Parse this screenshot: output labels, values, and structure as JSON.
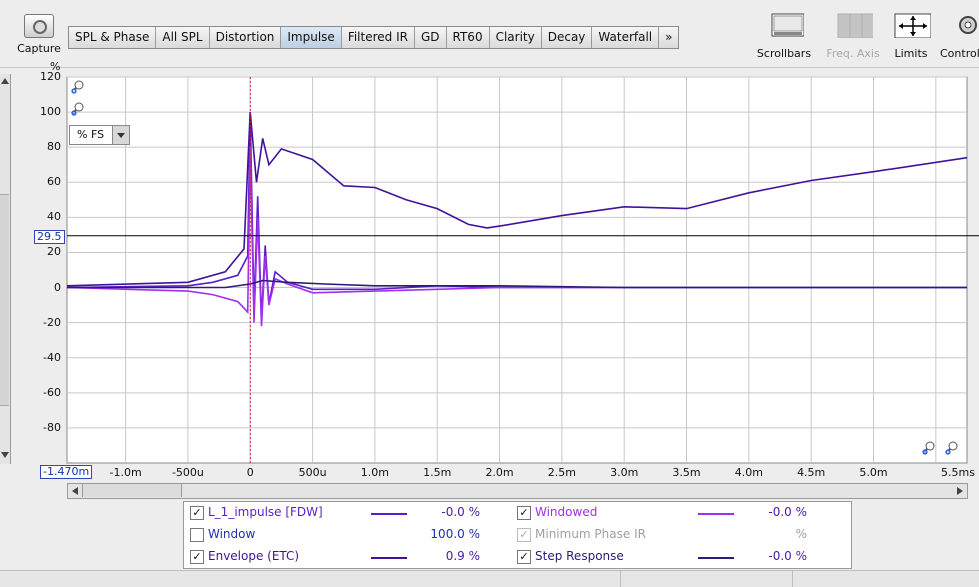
{
  "toolbar": {
    "capture_label": "Capture",
    "tabs": [
      "SPL & Phase",
      "All SPL",
      "Distortion",
      "Impulse",
      "Filtered IR",
      "GD",
      "RT60",
      "Clarity",
      "Decay",
      "Waterfall",
      "»"
    ],
    "active_tab": "Impulse",
    "scrollbars_label": "Scrollbars",
    "freq_axis_label": "Freq. Axis",
    "limits_label": "Limits",
    "controls_label": "Controls"
  },
  "plot": {
    "y_unit": "%",
    "unit_select_value": "% FS",
    "y_ticks": [
      "120",
      "100",
      "80",
      "60",
      "40",
      "20",
      "0",
      "-20",
      "-40",
      "-60",
      "-80"
    ],
    "x_ticks": [
      "-1.0m",
      "-500u",
      "0",
      "500u",
      "1.0m",
      "1.5m",
      "2.0m",
      "2.5m",
      "3.0m",
      "3.5m",
      "4.0m",
      "4.5m",
      "5.0m",
      "5.5ms"
    ],
    "cursor_y_readout": "29.5",
    "cursor_x_readout": "-1.470m"
  },
  "chart_data": {
    "type": "line",
    "title": "",
    "xlabel": "",
    "ylabel": "%",
    "x_unit": "ms",
    "xlim": [
      -1.47,
      5.75
    ],
    "ylim": [
      -100,
      120
    ],
    "grid": true,
    "series": [
      {
        "name": "L_1_impulse [FDW]",
        "color": "#5a1ec8",
        "x": [
          -1.47,
          -0.5,
          -0.3,
          -0.1,
          -0.02,
          0.0,
          0.03,
          0.06,
          0.09,
          0.12,
          0.15,
          0.2,
          0.3,
          0.5,
          1.0,
          1.5,
          2.0,
          3.0,
          4.0,
          5.0,
          5.75
        ],
        "y": [
          0,
          1,
          3,
          7,
          18,
          100,
          -12,
          52,
          -18,
          24,
          -9,
          9,
          3,
          -1,
          -1,
          1,
          0,
          0,
          0,
          0,
          0
        ]
      },
      {
        "name": "Windowed",
        "color": "#a030ee",
        "x": [
          -1.47,
          -0.5,
          -0.3,
          -0.1,
          -0.02,
          0.0,
          0.03,
          0.06,
          0.09,
          0.12,
          0.15,
          0.2,
          0.3,
          0.5,
          1.0,
          1.5,
          2.0,
          3.0,
          4.0,
          5.0,
          5.75
        ],
        "y": [
          0,
          -2,
          -4,
          -8,
          -14,
          80,
          -20,
          40,
          -22,
          18,
          -10,
          5,
          2,
          -3,
          -2,
          -1,
          0,
          0,
          0,
          0,
          0
        ]
      },
      {
        "name": "Envelope (ETC)",
        "color": "#40129c",
        "x": [
          -1.47,
          -0.5,
          -0.2,
          -0.05,
          0.0,
          0.05,
          0.1,
          0.15,
          0.25,
          0.5,
          0.75,
          1.0,
          1.25,
          1.5,
          1.75,
          1.9,
          2.0,
          2.5,
          3.0,
          3.5,
          4.0,
          4.5,
          5.0,
          5.75
        ],
        "y": [
          1,
          3,
          9,
          22,
          100,
          60,
          85,
          70,
          79,
          73,
          58,
          57,
          50,
          45,
          36,
          34,
          35,
          41,
          46,
          45,
          54,
          61,
          66,
          74
        ]
      },
      {
        "name": "Step Response",
        "color": "#2a1a7a",
        "x": [
          -1.47,
          -0.2,
          0.0,
          0.1,
          0.3,
          0.6,
          1.0,
          2.0,
          3.0,
          4.0,
          5.0,
          5.75
        ],
        "y": [
          0,
          0,
          2,
          4,
          3,
          2,
          1,
          1,
          0,
          0,
          0,
          0
        ]
      }
    ],
    "cursor": {
      "x": 0.0,
      "y": 29.5
    }
  },
  "legend": {
    "rows": [
      {
        "left": {
          "checked": true,
          "enabled": true,
          "name": "L_1_impulse [FDW]",
          "color": "#5a1ec8",
          "value": "-0.0 %"
        },
        "right": {
          "checked": true,
          "enabled": true,
          "name": "Windowed",
          "color": "#a030ee",
          "value": "-0.0 %"
        }
      },
      {
        "left": {
          "checked": false,
          "enabled": true,
          "name": "Window",
          "color": "",
          "value": "100.0 %"
        },
        "right": {
          "checked": true,
          "enabled": false,
          "name": "Minimum Phase IR",
          "color": "",
          "value": "%"
        }
      },
      {
        "left": {
          "checked": true,
          "enabled": true,
          "name": "Envelope (ETC)",
          "color": "#40129c",
          "value": "0.9 %"
        },
        "right": {
          "checked": true,
          "enabled": true,
          "name": "Step Response",
          "color": "#2a1a7a",
          "value": "-0.0 %"
        }
      }
    ]
  }
}
